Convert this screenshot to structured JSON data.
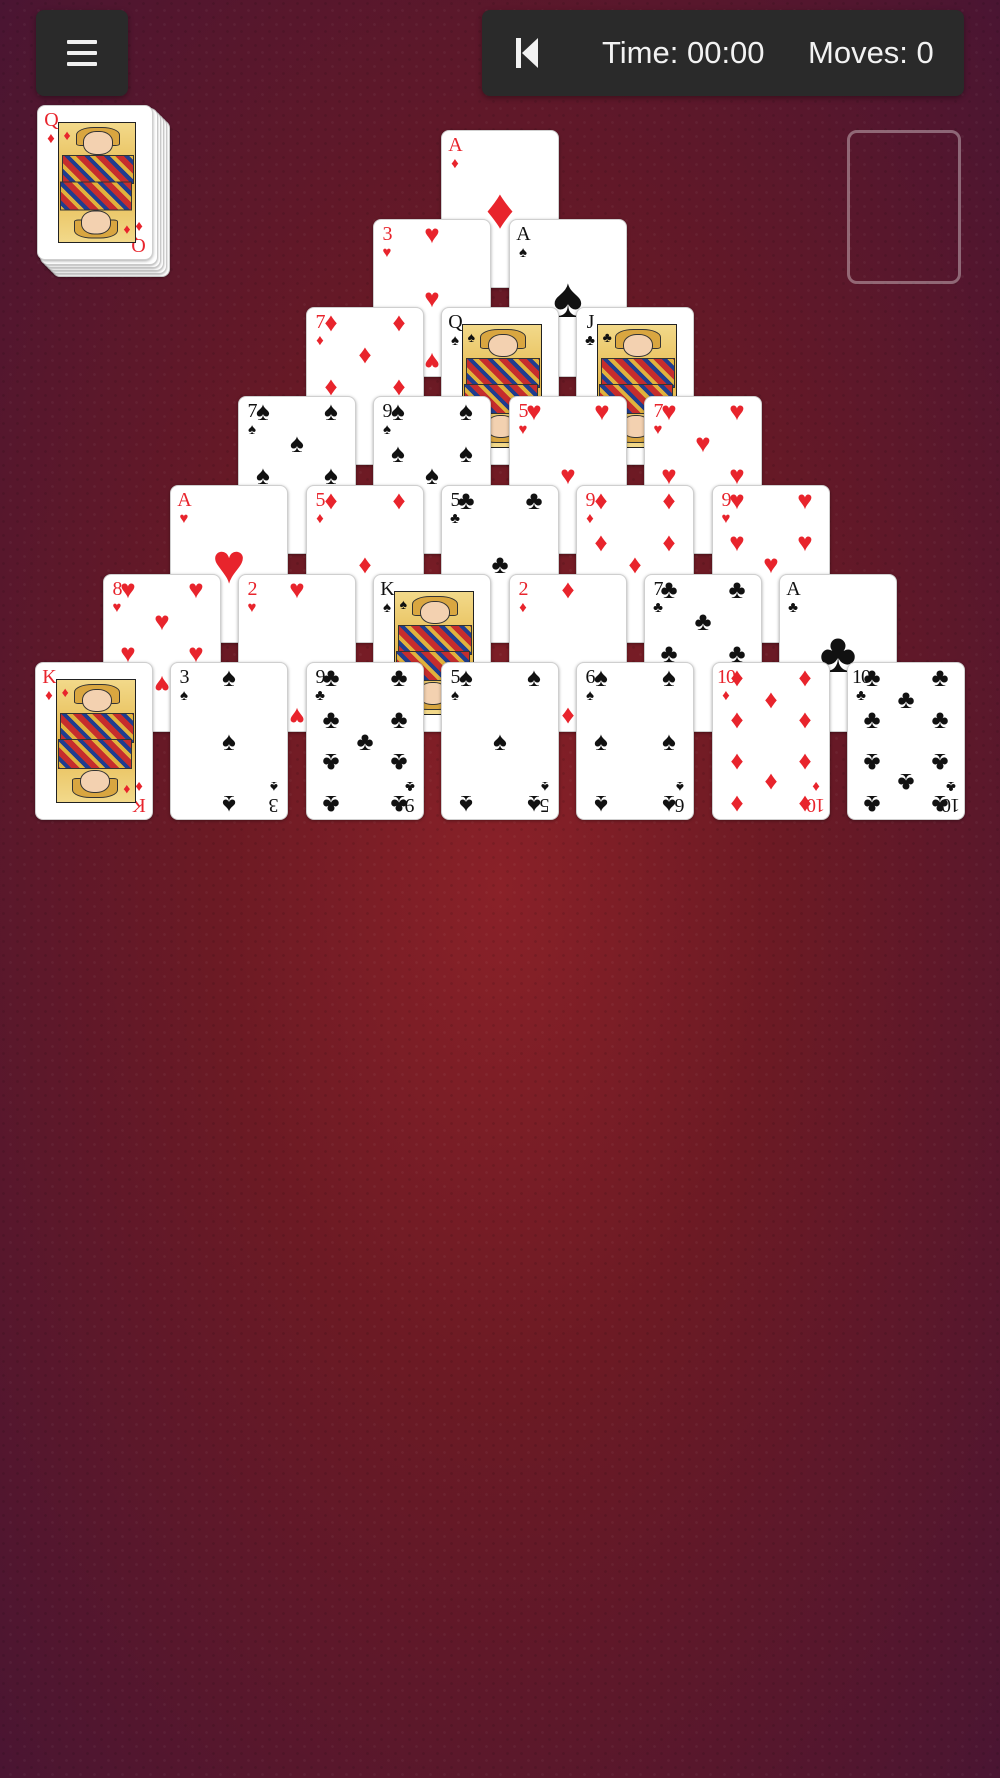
{
  "toolbar": {
    "menu_icon": "hamburger-menu-icon",
    "undo_icon": "skip-back-icon",
    "time_text": "Time: 00:00",
    "moves_text": "Moves: 0"
  },
  "colors": {
    "table": "#6c1a24",
    "panel": "#2a2a2a",
    "red_suit": "#e8242c",
    "black_suit": "#111111"
  },
  "suit_glyphs": {
    "hearts": "♥",
    "diamonds": "♦",
    "clubs": "♣",
    "spades": "♠"
  },
  "stock": {
    "top_card": {
      "rank": "Q",
      "suit": "diamonds"
    }
  },
  "waste": {
    "empty": true
  },
  "pyramid": [
    [
      {
        "rank": "A",
        "suit": "diamonds"
      }
    ],
    [
      {
        "rank": "3",
        "suit": "hearts"
      },
      {
        "rank": "A",
        "suit": "spades"
      }
    ],
    [
      {
        "rank": "7",
        "suit": "diamonds"
      },
      {
        "rank": "Q",
        "suit": "spades"
      },
      {
        "rank": "J",
        "suit": "clubs"
      }
    ],
    [
      {
        "rank": "7",
        "suit": "spades"
      },
      {
        "rank": "9",
        "suit": "spades"
      },
      {
        "rank": "5",
        "suit": "hearts"
      },
      {
        "rank": "7",
        "suit": "hearts"
      }
    ],
    [
      {
        "rank": "A",
        "suit": "hearts"
      },
      {
        "rank": "5",
        "suit": "diamonds"
      },
      {
        "rank": "5",
        "suit": "clubs"
      },
      {
        "rank": "9",
        "suit": "diamonds"
      },
      {
        "rank": "9",
        "suit": "hearts"
      }
    ],
    [
      {
        "rank": "8",
        "suit": "hearts"
      },
      {
        "rank": "2",
        "suit": "hearts"
      },
      {
        "rank": "K",
        "suit": "spades"
      },
      {
        "rank": "2",
        "suit": "diamonds"
      },
      {
        "rank": "7",
        "suit": "clubs"
      },
      {
        "rank": "A",
        "suit": "clubs"
      }
    ],
    [
      {
        "rank": "K",
        "suit": "diamonds"
      },
      {
        "rank": "3",
        "suit": "spades"
      },
      {
        "rank": "9",
        "suit": "clubs"
      },
      {
        "rank": "5",
        "suit": "spades"
      },
      {
        "rank": "6",
        "suit": "spades"
      },
      {
        "rank": "10",
        "suit": "diamonds"
      },
      {
        "rank": "10",
        "suit": "clubs"
      }
    ]
  ]
}
